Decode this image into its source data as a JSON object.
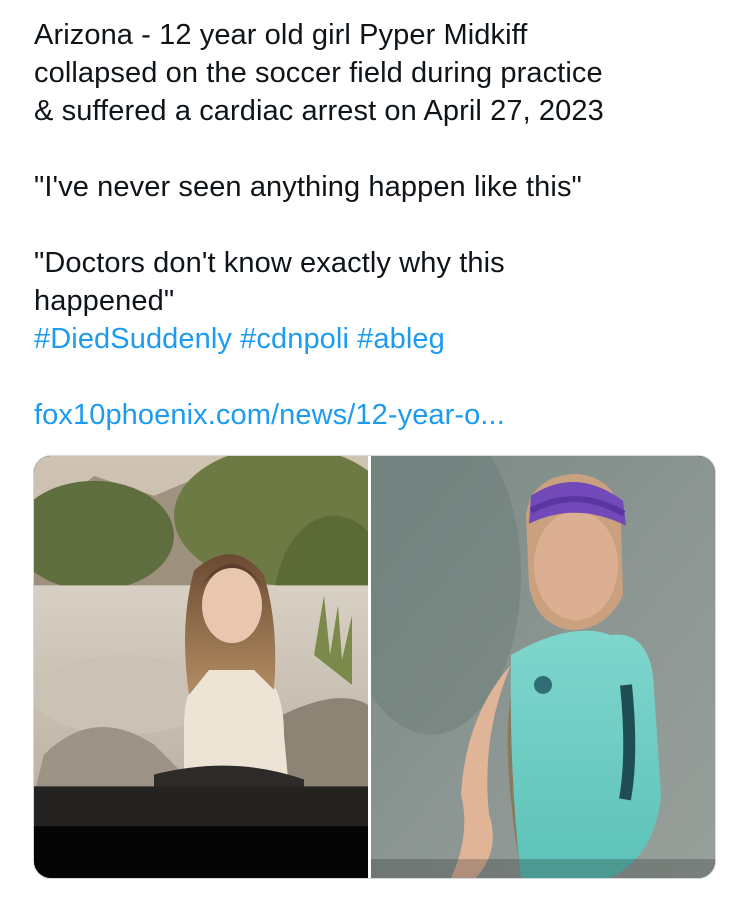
{
  "tweet": {
    "lines": [
      "Arizona - 12 year old girl Pyper Midkiff",
      "collapsed on the soccer field during practice",
      "& suffered a cardiac arrest on April 27, 2023",
      "\"I've never seen anything happen like this\"",
      "\"Doctors don't know exactly why this",
      "happened\""
    ],
    "hashtags": [
      "#DiedSuddenly",
      "#cdnpoli",
      "#ableg"
    ],
    "link": "fox10phoenix.com/news/12-year-o..."
  },
  "media": {
    "photos": [
      {
        "icon": "photo-girl-sitting-on-rock"
      },
      {
        "icon": "photo-girl-soccer-jersey"
      }
    ]
  },
  "colors": {
    "text": "#0f1419",
    "link": "#1d9bf0",
    "card_border": "#cfd9de"
  }
}
